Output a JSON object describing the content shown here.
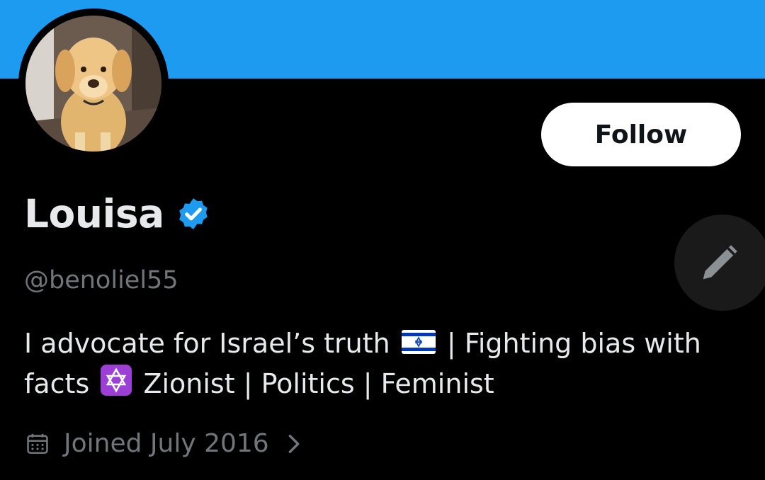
{
  "header": {
    "banner_color": "#1d9bf0"
  },
  "profile": {
    "avatar_description": "golden-retriever-dog-photo",
    "follow_label": "Follow",
    "display_name": "Louisa",
    "verified": true,
    "handle": "@benoliel55",
    "bio_line1_a": "I advocate for Israel’s truth",
    "bio_line1_b": "| Fighting bias with",
    "bio_line2_a": "facts",
    "bio_line2_b": "Zionist | Politics | Feminist",
    "joined": "Joined July 2016"
  },
  "icons": {
    "verified": "verified-badge-icon",
    "israel_flag": "israel-flag-icon",
    "star_of_david": "star-of-david-icon",
    "calendar": "calendar-icon",
    "chevron": "chevron-right-icon",
    "edit": "pencil-icon"
  },
  "colors": {
    "background": "#000000",
    "primary_text": "#e7e9ea",
    "secondary_text": "#71767b",
    "accent": "#1d9bf0"
  }
}
